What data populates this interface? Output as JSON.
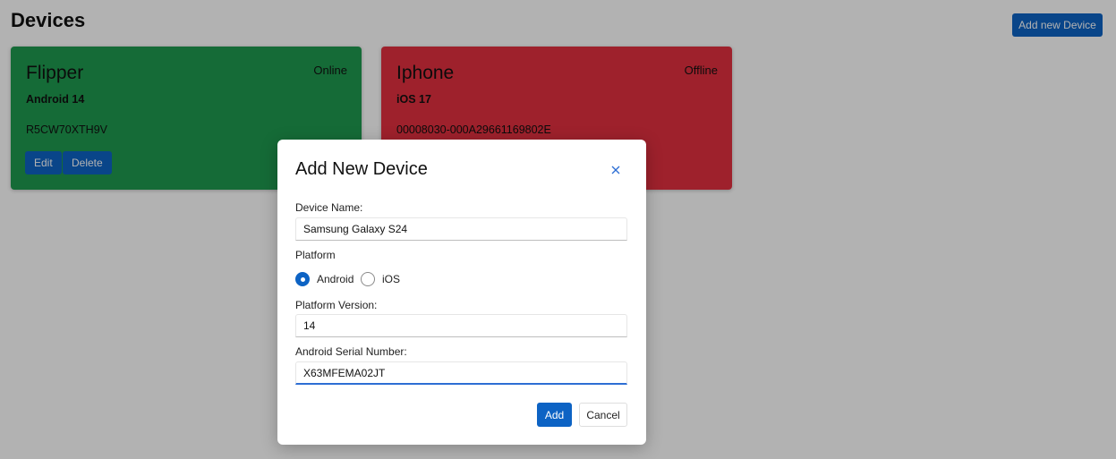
{
  "page": {
    "title": "Devices",
    "add_button_label": "Add new Device"
  },
  "devices": [
    {
      "name": "Flipper",
      "status": "Online",
      "platform": "Android 14",
      "serial": "R5CW70XTH9V",
      "edit_label": "Edit",
      "delete_label": "Delete",
      "color": "#1f9a4f"
    },
    {
      "name": "Iphone",
      "status": "Offline",
      "platform": "iOS 17",
      "serial": "00008030-000A29661169802E",
      "color": "#e3303f"
    }
  ],
  "modal": {
    "title": "Add New Device",
    "close_icon": "close-icon",
    "device_name_label": "Device Name:",
    "device_name_value": "Samsung Galaxy S24",
    "platform_label": "Platform",
    "platform_options": [
      {
        "label": "Android",
        "checked": true
      },
      {
        "label": "iOS",
        "checked": false
      }
    ],
    "platform_version_label": "Platform Version:",
    "platform_version_value": "14",
    "serial_label": "Android Serial Number:",
    "serial_value": "X63MFEMA02JT",
    "add_label": "Add",
    "cancel_label": "Cancel"
  },
  "colors": {
    "primary": "#0d63c4",
    "online": "#1f9a4f",
    "offline": "#e3303f"
  }
}
